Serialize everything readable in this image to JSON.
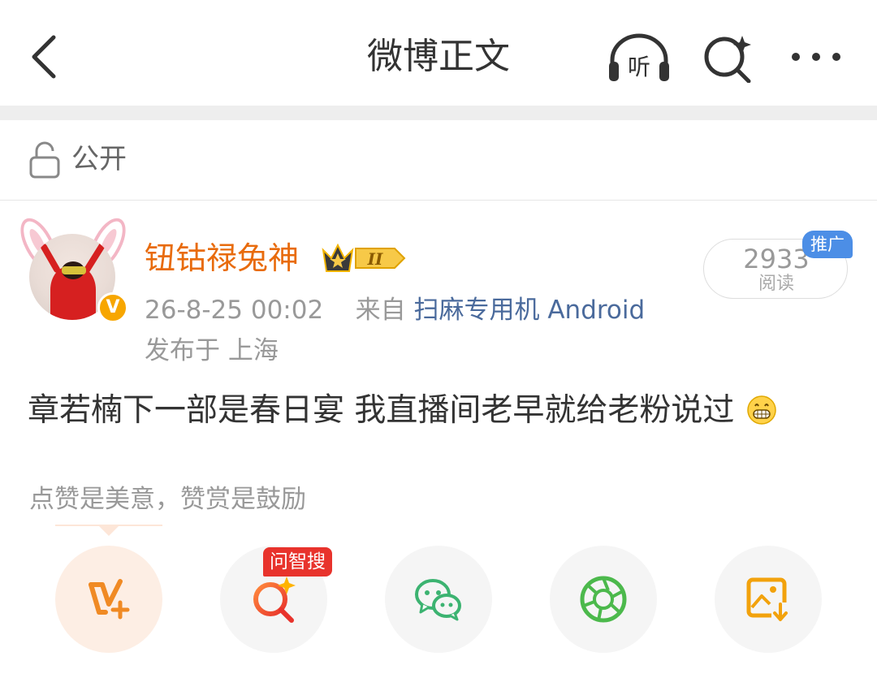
{
  "nav": {
    "title": "微博正文",
    "listen_label": "听"
  },
  "visibility": {
    "label": "公开"
  },
  "author": {
    "name": "钮钴禄兔神",
    "verified_mark": "V",
    "member_level": "II"
  },
  "meta": {
    "timestamp": "26-8-25 00:02",
    "from_prefix": "来自",
    "source": "扫麻专用机 Android",
    "location": "发布于 上海"
  },
  "reads": {
    "count": "2933",
    "label": "阅读",
    "promo_tag": "推广"
  },
  "post": {
    "text": "章若楠下一部是春日宴  我直播间老早就给老粉说过",
    "emoji": "grinning-face-emoji"
  },
  "tip": {
    "text": "点赞是美意，赞赏是鼓励"
  },
  "actions": {
    "wenzhisou_tag": "问智搜",
    "items": [
      {
        "icon": "v-plus-icon"
      },
      {
        "icon": "smart-search-icon"
      },
      {
        "icon": "wechat-icon"
      },
      {
        "icon": "moments-icon"
      },
      {
        "icon": "save-image-icon"
      }
    ]
  },
  "colors": {
    "username": "#e86b0c",
    "source_link": "#4a6a9c",
    "accent_orange": "#f08a24",
    "wechat_green": "#3cb371",
    "promo_blue": "#4c8ee6",
    "tag_red": "#e8332c"
  }
}
